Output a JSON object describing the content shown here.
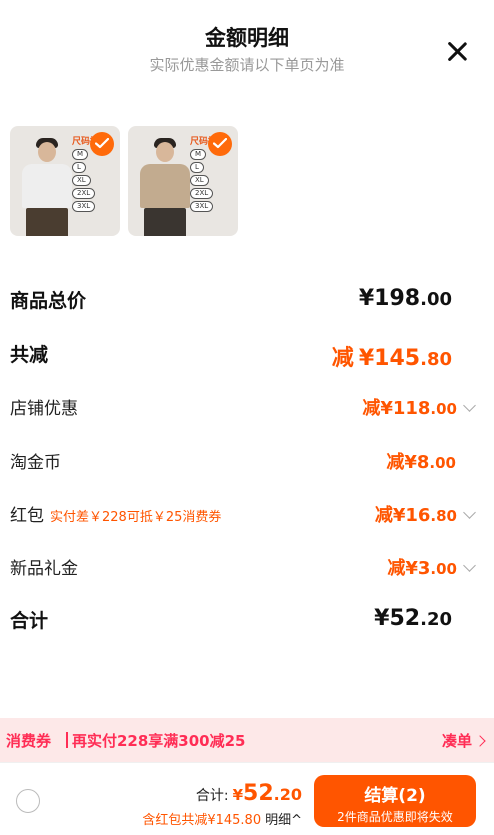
{
  "header": {
    "title": "金额明细",
    "subtitle": "实际优惠金额请以下单页为准",
    "close_icon": "close-icon"
  },
  "products": [
    {
      "size_chart_title": "尺码推荐",
      "sizes": [
        "M",
        "L",
        "XL",
        "2XL",
        "3XL"
      ],
      "shirt_color": "#eeeeee",
      "pants_color": "#4a3d30"
    },
    {
      "size_chart_title": "尺码推荐",
      "sizes": [
        "M",
        "L",
        "XL",
        "2XL",
        "3XL"
      ],
      "shirt_color": "#c2ab8f",
      "pants_color": "#3a3530"
    }
  ],
  "rows": {
    "subtotal": {
      "label": "商品总价",
      "symbol": "¥",
      "int": "198",
      "dec": ".00"
    },
    "total_discount": {
      "label": "共减",
      "prefix": "减",
      "symbol": "¥",
      "int": "145",
      "dec": ".80"
    },
    "shop": {
      "label": "店铺优惠",
      "prefix": "减",
      "symbol": "¥",
      "int": "118",
      "dec": ".00"
    },
    "coins": {
      "label": "淘金币",
      "prefix": "减",
      "symbol": "¥",
      "int": "8",
      "dec": ".00"
    },
    "redpacket": {
      "label": "红包",
      "note": "实付差￥228可抵￥25消费券",
      "prefix": "减",
      "symbol": "¥",
      "int": "16",
      "dec": ".80"
    },
    "gift": {
      "label": "新品礼金",
      "prefix": "减",
      "symbol": "¥",
      "int": "3",
      "dec": ".00"
    },
    "total": {
      "label": "合计",
      "symbol": "¥",
      "int": "52",
      "dec": ".20"
    }
  },
  "promo": {
    "tag": "消费券",
    "message": "再实付228享满300减25",
    "action": "凑单"
  },
  "bottom": {
    "total_label": "合计:",
    "total_symbol": "¥",
    "total_int": "52",
    "total_dec": ".20",
    "discount_text": "含红包共减¥145.80",
    "detail_text": "明细^",
    "checkout_label": "结算(2)",
    "checkout_sub": "2件商品优惠即将失效"
  },
  "colors": {
    "accent": "#ff5500",
    "promo_bg": "#fde8e8",
    "promo_text": "#ff2d55"
  }
}
